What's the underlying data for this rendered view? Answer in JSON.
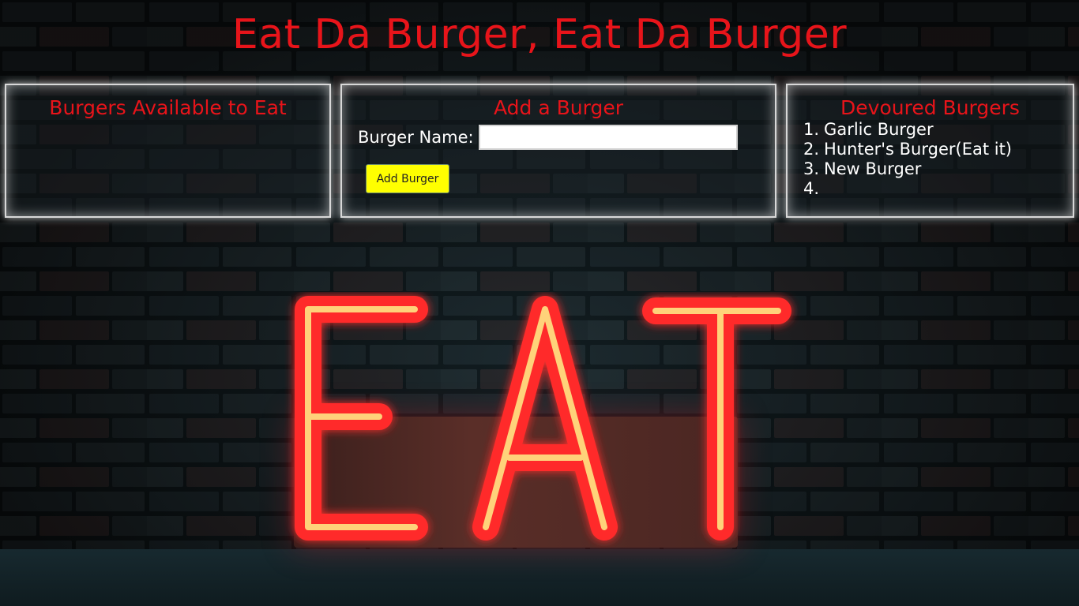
{
  "page": {
    "title": "Eat Da Burger, Eat Da Burger"
  },
  "available": {
    "heading": "Burgers Available to Eat",
    "items": []
  },
  "add": {
    "heading": "Add a Burger",
    "label": "Burger Name:",
    "input_value": "",
    "button_label": "Add Burger"
  },
  "devoured": {
    "heading": "Devoured Burgers",
    "items": [
      {
        "num": "1.",
        "name": "Garlic Burger"
      },
      {
        "num": "2.",
        "name": "Hunter's Burger(Eat it)"
      },
      {
        "num": "3.",
        "name": "New Burger"
      },
      {
        "num": "4.",
        "name": ""
      }
    ]
  },
  "colors": {
    "heading_red": "#e8141a",
    "button_yellow": "#ffff00"
  },
  "background": {
    "sign_text": "EAT"
  }
}
